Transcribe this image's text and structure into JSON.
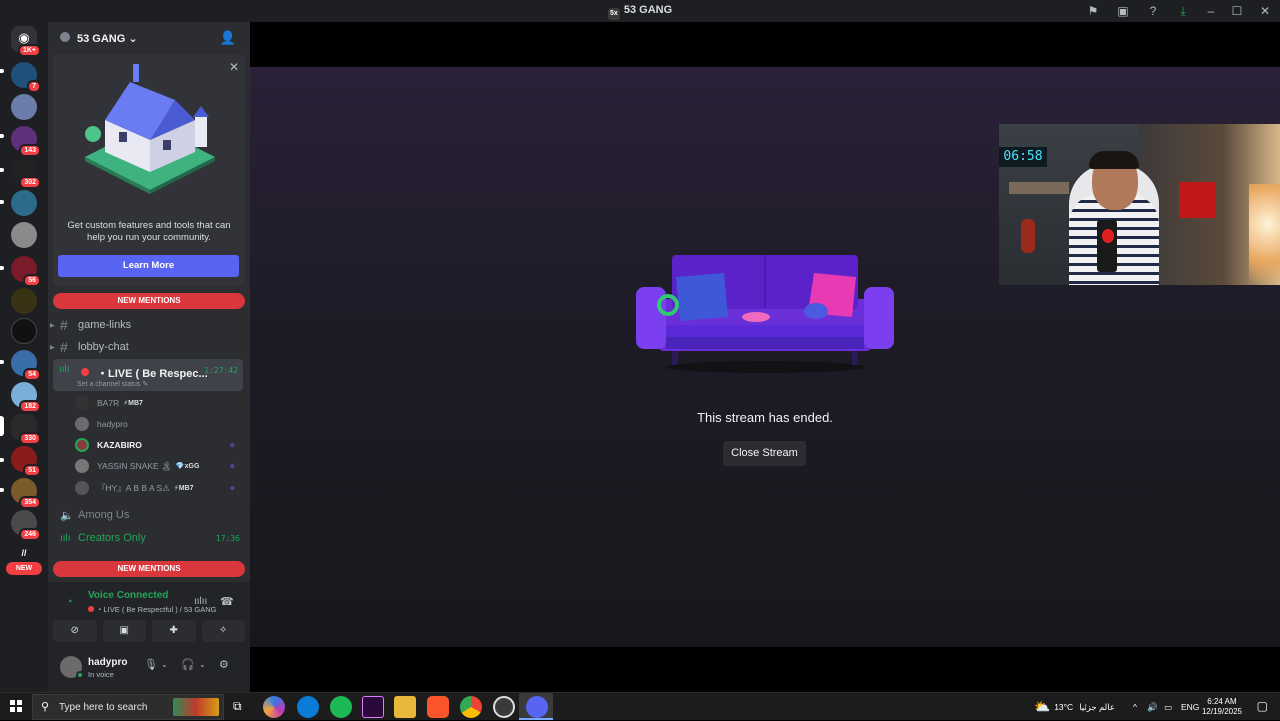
{
  "window": {
    "title": "53 GANG",
    "title_icon_text": "5x"
  },
  "guild_badges": [
    "1K+",
    "7",
    "143",
    "302",
    "56",
    "54",
    "182",
    "330",
    "51",
    "354",
    "246",
    "NEW"
  ],
  "server": {
    "name": "53 GANG"
  },
  "promo": {
    "text": "Get custom features and tools that can help you run your community.",
    "button": "Learn More"
  },
  "new_mentions": "NEW MENTIONS",
  "channels": {
    "game_links": "game-links",
    "lobby_chat": "lobby-chat",
    "live_channel": "・LIVE ( Be Respec...",
    "live_status": "Set a channel status",
    "live_timer": "1:27:42",
    "among_us": "Among Us",
    "creators_only": "Creators Only",
    "creators_timer": "17:36"
  },
  "voice_users": [
    {
      "name": "BA7R",
      "tag": "⚡MB7"
    },
    {
      "name": "hadypro",
      "tag": ""
    },
    {
      "name": "KAZABIRO",
      "tag": ""
    },
    {
      "name": "YASSIN SNAKE 🏝",
      "tag": "💎xGG"
    },
    {
      "name": "『HY』A B B A S⚠",
      "tag": "⚡MB7"
    }
  ],
  "voice_connected": {
    "label": "Voice Connected",
    "channel": "・LIVE ( Be Respectful ) / 53 GANG"
  },
  "user": {
    "name": "hadypro",
    "status": "In voice"
  },
  "stream": {
    "ended_text": "This stream has ended.",
    "close_button": "Close Stream",
    "clock_display": "06:58"
  },
  "taskbar": {
    "search_placeholder": "Type here to search",
    "weather": "13°C",
    "weather_label": "عالم جزئيا",
    "language": "ENG",
    "time": "6:24 AM",
    "date": "12/19/2025"
  }
}
